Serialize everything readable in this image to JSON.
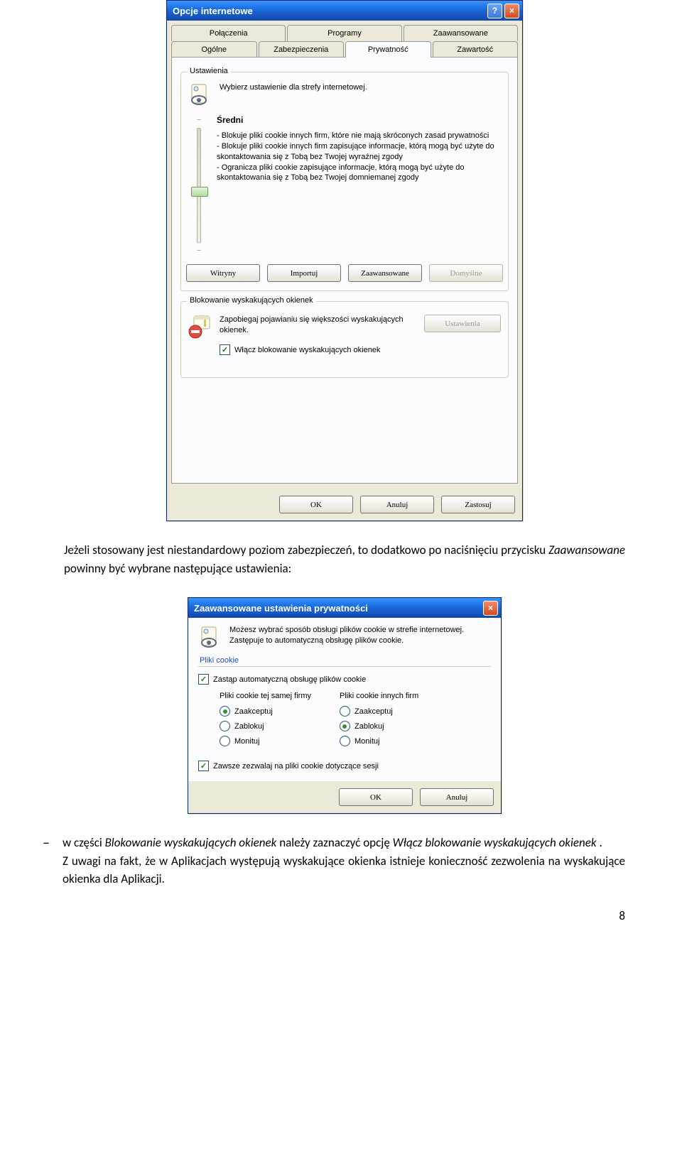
{
  "dialog1": {
    "title": "Opcje internetowe",
    "tabs_row1": [
      "Połączenia",
      "Programy",
      "Zaawansowane"
    ],
    "tabs_row2": [
      "Ogólne",
      "Zabezpieczenia",
      "Prywatność",
      "Zawartość"
    ],
    "active_tab": "Prywatność",
    "settings_group": "Ustawienia",
    "settings_intro": "Wybierz ustawienie dla strefy internetowej.",
    "level_name": "Średni",
    "level_lines": [
      "- Blokuje pliki cookie innych firm, które nie mają skróconych zasad prywatności",
      "- Blokuje pliki cookie innych firm zapisujące informacje, którą mogą być użyte do skontaktowania się z Tobą bez Twojej wyraźnej zgody",
      "- Ogranicza pliki cookie zapisujące informacje, którą mogą być użyte do skontaktowania się z Tobą bez Twojej domniemanej zgody"
    ],
    "buttons_mid": {
      "sites": "Witryny",
      "import": "Importuj",
      "advanced": "Zaawansowane",
      "default": "Domyślne"
    },
    "popup_group": "Blokowanie wyskakujących okienek",
    "popup_desc": "Zapobiegaj pojawianiu się większości wyskakujących okienek.",
    "popup_settings_btn": "Ustawienia",
    "popup_checkbox": "Włącz blokowanie wyskakujących okienek",
    "bottom_buttons": {
      "ok": "OK",
      "cancel": "Anuluj",
      "apply": "Zastosuj"
    }
  },
  "para1": {
    "prefix": "Jeżeli stosowany jest niestandardowy poziom zabezpieczeń, to dodatkowo po naciśnięciu przycisku ",
    "btn": "Zaawansowane",
    "suffix": " powinny być wybrane następujące ustawienia:"
  },
  "dialog2": {
    "title": "Zaawansowane ustawienia prywatności",
    "intro": "Możesz wybrać sposób obsługi plików cookie w strefie internetowej. Zastępuje to automatyczną obsługę plików cookie.",
    "section": "Pliki cookie",
    "override": "Zastąp automatyczną obsługę plików cookie",
    "col1_title": "Pliki cookie tej samej firmy",
    "col2_title": "Pliki cookie innych firm",
    "options": [
      "Zaakceptuj",
      "Zablokuj",
      "Monituj"
    ],
    "col1_selected": 0,
    "col2_selected": 1,
    "always_session": "Zawsze zezwalaj na pliki cookie dotyczące sesji",
    "ok": "OK",
    "cancel": "Anuluj"
  },
  "para2": {
    "line1_prefix": "w części ",
    "line1_group": "Blokowanie wyskakujących okienek",
    "line1_mid": " należy zaznaczyć opcję ",
    "line1_opt": "Włącz blokowanie wyskakujących okienek",
    "line1_end": ".",
    "line2": "Z uwagi na fakt, że w Aplikacjach występują wyskakujące okienka istnieje konieczność zezwolenia na wyskakujące okienka dla Aplikacji."
  },
  "page_number": "8"
}
